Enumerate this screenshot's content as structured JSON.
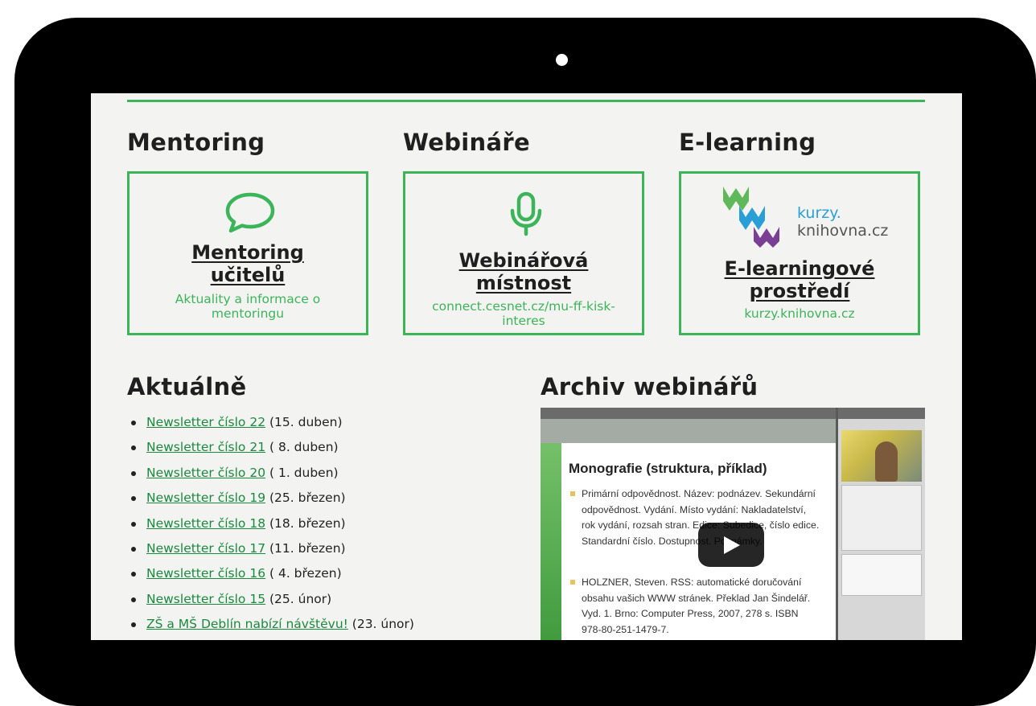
{
  "sections": {
    "mentoring": {
      "heading": "Mentoring",
      "card_title_line1": "Mentoring",
      "card_title_line2": "učitelů",
      "card_sub_line1": "Aktuality a informace o",
      "card_sub_line2": "mentoringu"
    },
    "webinars": {
      "heading": "Webináře",
      "card_title_line1": "Webinářová",
      "card_title_line2": "místnost",
      "card_sub_line1": "connect.cesnet.cz/mu-ff-kisk-",
      "card_sub_line2": "interes"
    },
    "elearning": {
      "heading": "E-learning",
      "logo_line1": "kurzy.",
      "logo_line2": "knihovna.cz",
      "card_title_line1": "E-learningové",
      "card_title_line2": "prostředí",
      "card_sub_line1": "kurzy.knihovna.cz"
    }
  },
  "news": {
    "heading": "Aktuálně",
    "items": [
      {
        "link": "Newsletter číslo 22",
        "date": " (15. duben)"
      },
      {
        "link": "Newsletter číslo 21",
        "date": " ( 8. duben)"
      },
      {
        "link": "Newsletter číslo 20",
        "date": " ( 1. duben)"
      },
      {
        "link": "Newsletter číslo 19",
        "date": " (25. březen)"
      },
      {
        "link": "Newsletter číslo 18",
        "date": " (18. březen)"
      },
      {
        "link": "Newsletter číslo 17",
        "date": " (11. březen)"
      },
      {
        "link": "Newsletter číslo 16",
        "date": " ( 4. březen)"
      },
      {
        "link": "Newsletter číslo 15",
        "date": " (25. únor)"
      },
      {
        "link": "ZŠ a MŠ Deblín nabízí návštěvu!",
        "date": " (23. únor)"
      }
    ]
  },
  "archive": {
    "heading": "Archiv webinářů",
    "slide_title": "Monografie (struktura, příklad)",
    "slide_bullet1": "Primární odpovědnost. Název: podnázev. Sekundární odpovědnost. Vydání. Místo vydání: Nakladatelství, rok vydání, rozsah stran. Edice: Subedice, číslo edice. Standardní číslo. Dostupnost. Poznámky.",
    "slide_bullet2": "HOLZNER, Steven. RSS: automatické doručování obsahu vašich WWW stránek. Překlad Jan Šindelář. Vyd. 1. Brno: Computer Press, 2007, 278 s. ISBN 978-80-251-1479-7."
  },
  "colors": {
    "accent": "#3cb45a",
    "link": "#1a8a3f",
    "logo_blue": "#2a9fd6",
    "logo_purple": "#7b3e95",
    "frame": "#000000",
    "screen_bg": "#f3f3f1"
  },
  "icons": {
    "mentoring": "speech-bubble-icon",
    "webinars": "microphone-icon",
    "play": "play-icon"
  }
}
